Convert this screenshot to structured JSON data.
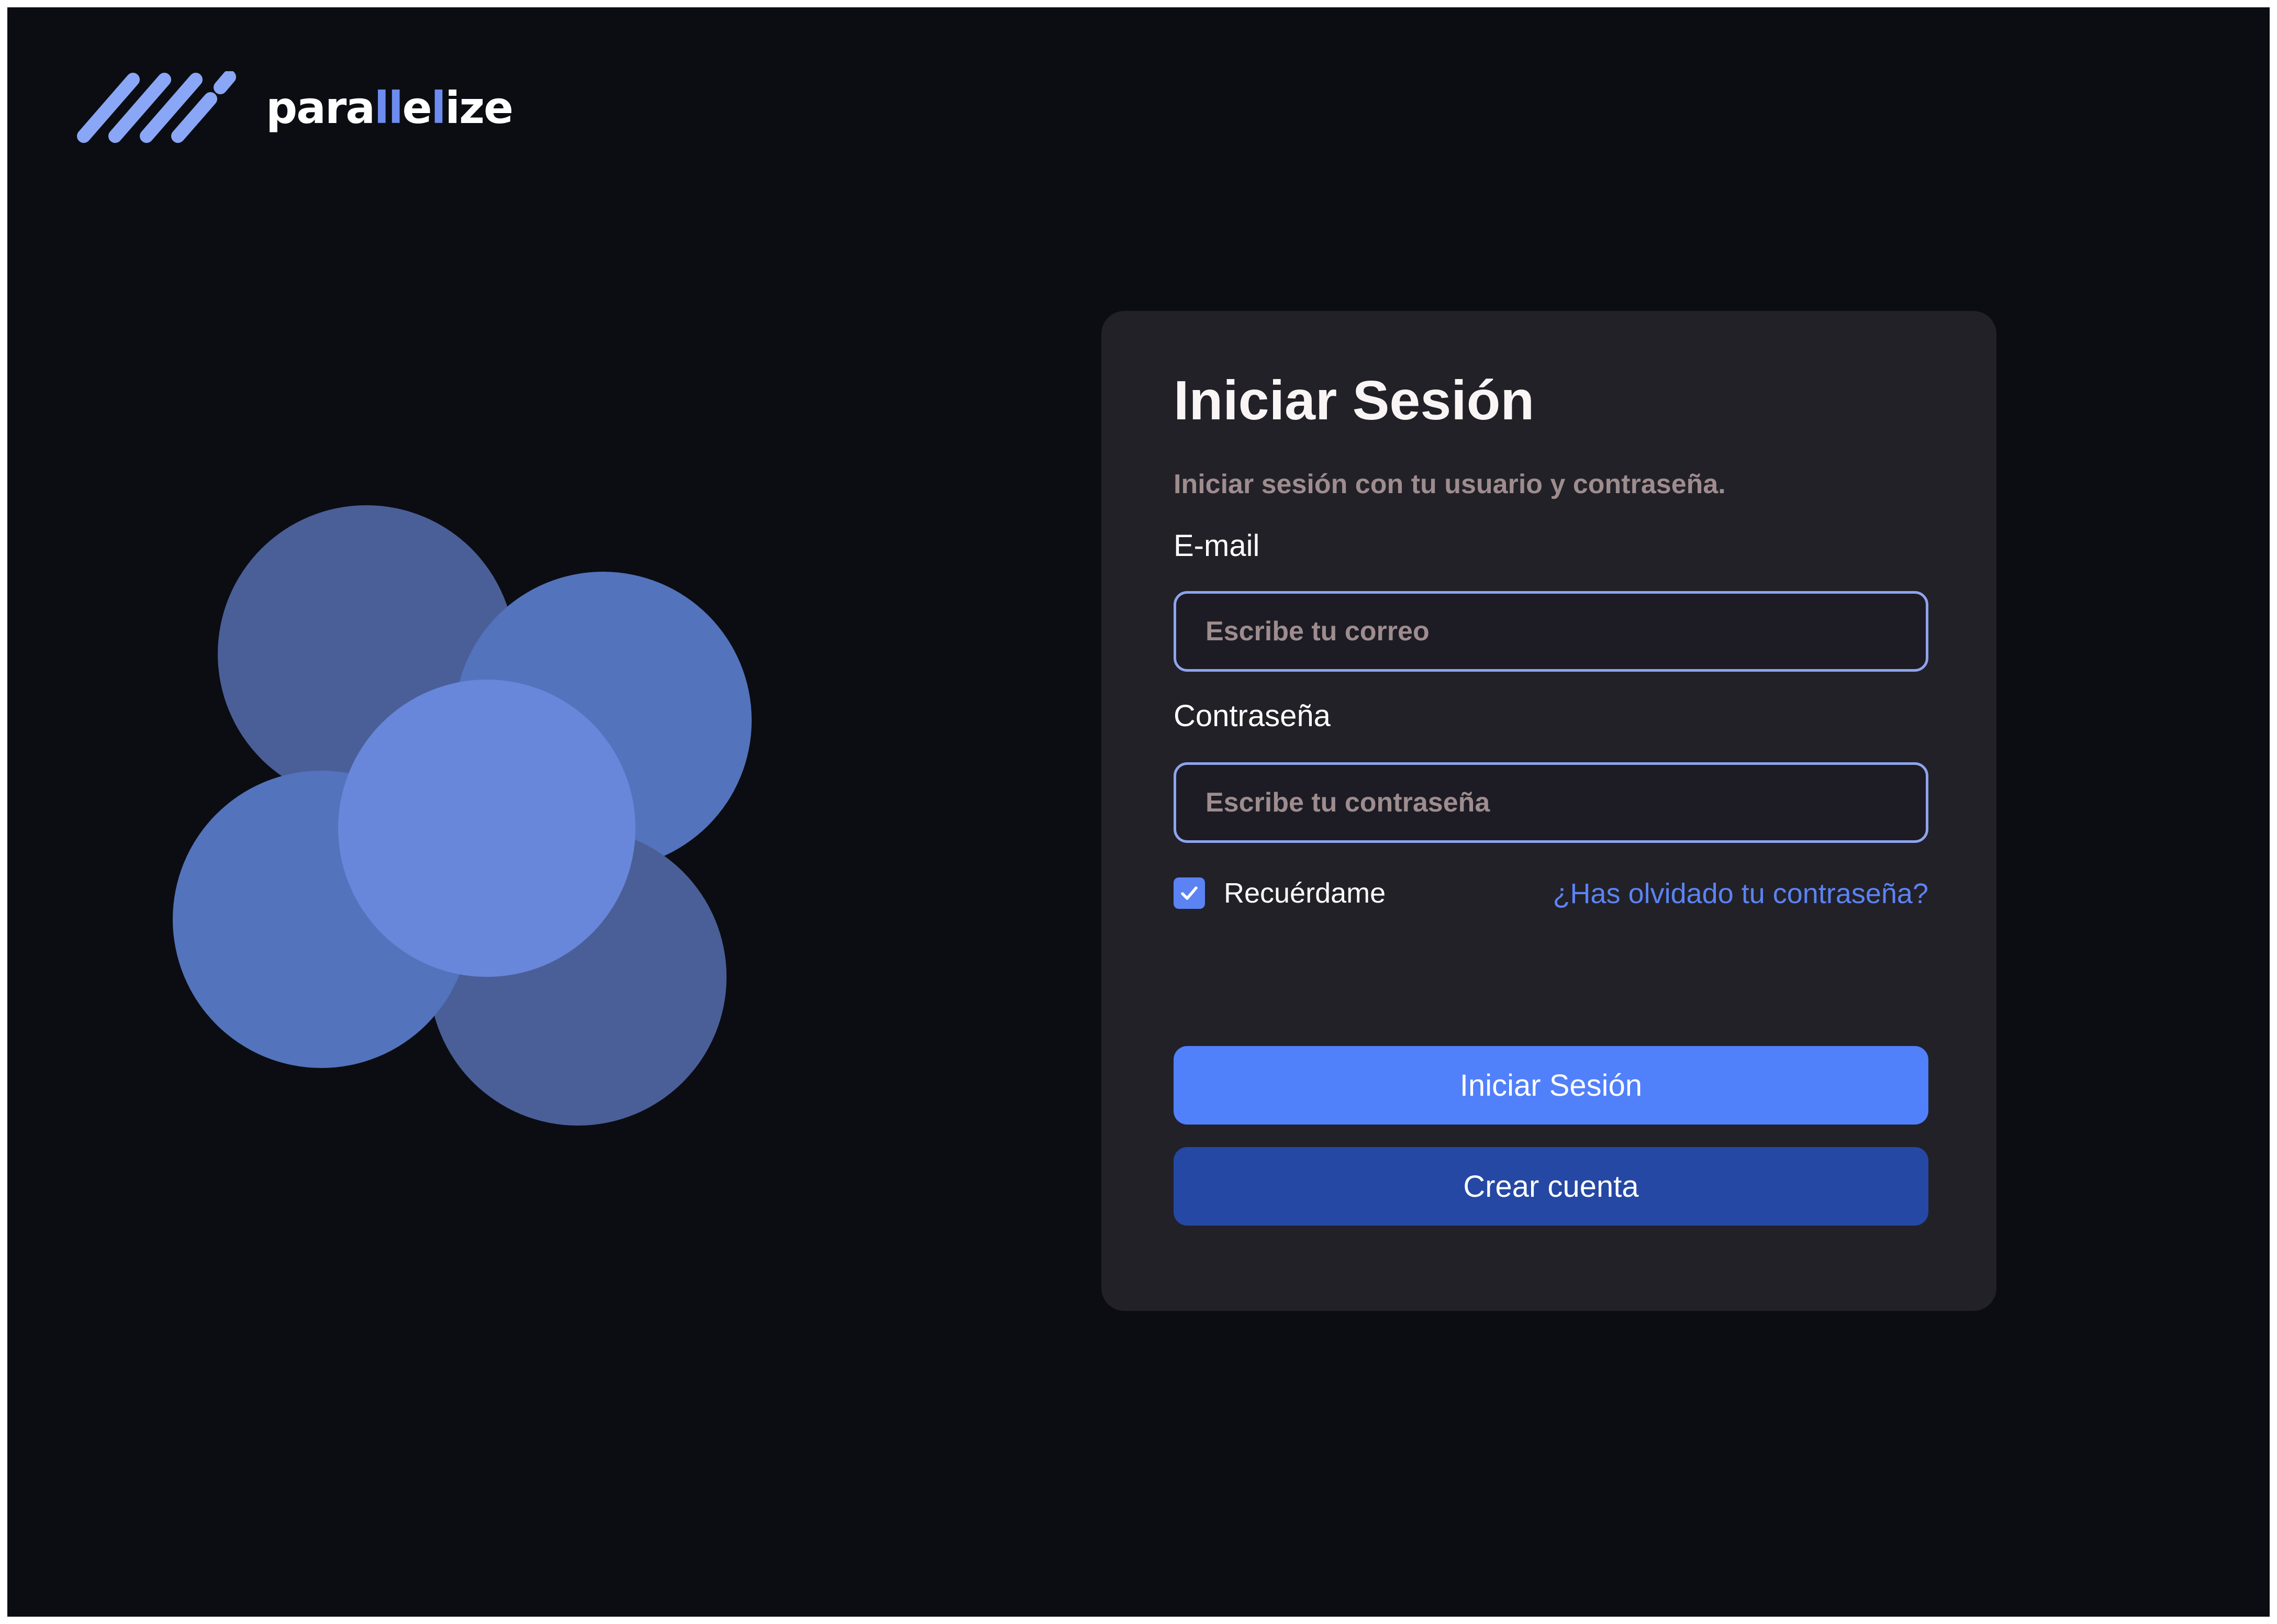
{
  "brand": {
    "name_parts": [
      "para",
      "ll",
      "e",
      "l",
      "ize"
    ],
    "accent_color": "#6d8cf0",
    "mark_icon": "parallel-stripes-icon"
  },
  "login": {
    "title": "Iniciar Sesión",
    "subtitle": "Iniciar sesión con tu usuario y contraseña.",
    "email": {
      "label": "E-mail",
      "value": "",
      "placeholder": "Escribe tu correo"
    },
    "password": {
      "label": "Contraseña",
      "value": "",
      "placeholder": "Escribe tu contraseña"
    },
    "remember": {
      "label": "Recuérdame",
      "checked": true
    },
    "forgot_link": "¿Has olvidado tu contraseña?",
    "submit_label": "Iniciar Sesión",
    "create_account_label": "Crear cuenta"
  },
  "colors": {
    "background": "#0c0d13",
    "card": "#222128",
    "primary_button": "#5180fb",
    "secondary_button": "#2548a4",
    "input_border": "#8ea4ec",
    "link": "#5b83f4",
    "muted_text": "#9e8c8e"
  }
}
